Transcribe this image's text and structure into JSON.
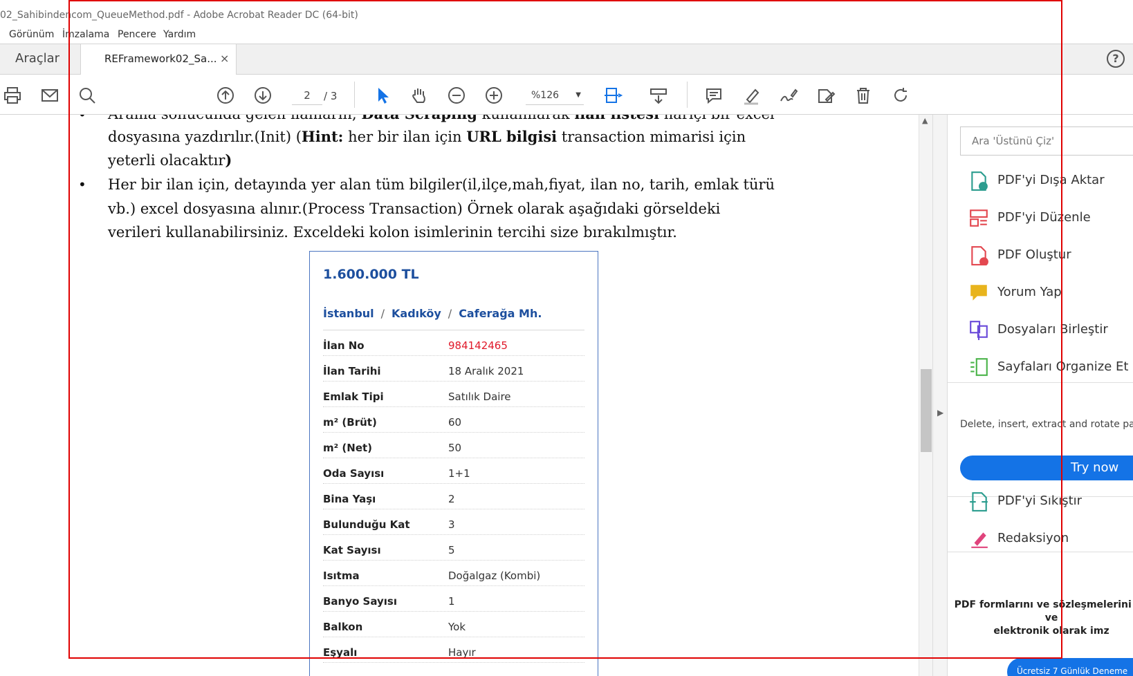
{
  "window": {
    "title": "02_Sahibindencom_QueueMethod.pdf - Adobe Acrobat Reader DC (64-bit)"
  },
  "menu": [
    "Görünüm",
    "İmzalama",
    "Pencere",
    "Yardım"
  ],
  "tabs": {
    "tools": "Araçlar",
    "document": "REFramework02_Sa...",
    "close": "×",
    "help": "?"
  },
  "toolbar": {
    "page_current": "2",
    "page_total": "/ 3",
    "zoom": "%126"
  },
  "document": {
    "lines": [
      "Arama sonucunda gelen ilanların, Data Scraping kullanılarak ilan listesi hariçi bir excel",
      "dosyasına yazdırılır.(Init) (Hint: her bir ilan için URL bilgisi transaction mimarisi için",
      "yeterli olacaktır)",
      "Her bir ilan için, detayında yer alan tüm bilgiler(il,ilçe,mah,fiyat, ilan no, tarih, emlak türü",
      "vb.) excel dosyasına alınır.(Process Transaction) Örnek olarak aşağıdaki görseldeki",
      "verileri kullanabilirsiniz. Exceldeki kolon isimlerinin tercihi size bırakılmıştır."
    ],
    "bold": {
      "hint": "Hint:",
      "url": "URL bilgisi",
      "data_scraping": "Data Scraping",
      "ilan_listesi": "ilan listesi",
      "paren": ")"
    }
  },
  "listing": {
    "price": "1.600.000 TL",
    "location": [
      "İstanbul",
      "Kadıköy",
      "Caferağa Mh."
    ],
    "separator": "/",
    "rows": [
      {
        "k": "İlan No",
        "v": "984142465"
      },
      {
        "k": "İlan Tarihi",
        "v": "18 Aralık 2021"
      },
      {
        "k": "Emlak Tipi",
        "v": "Satılık Daire"
      },
      {
        "k": "m² (Brüt)",
        "v": "60"
      },
      {
        "k": "m² (Net)",
        "v": "50"
      },
      {
        "k": "Oda Sayısı",
        "v": "1+1"
      },
      {
        "k": "Bina Yaşı",
        "v": "2"
      },
      {
        "k": "Bulunduğu Kat",
        "v": "3"
      },
      {
        "k": "Kat Sayısı",
        "v": "5"
      },
      {
        "k": "Isıtma",
        "v": "Doğalgaz (Kombi)"
      },
      {
        "k": "Banyo Sayısı",
        "v": "1"
      },
      {
        "k": "Balkon",
        "v": "Yok"
      },
      {
        "k": "Eşyalı",
        "v": "Hayır"
      }
    ]
  },
  "pane": {
    "search_placeholder": "Ara 'Üstünü Çiz'",
    "tools": [
      {
        "label": "PDF'yi Dışa Aktar",
        "icon": "export-pdf-icon",
        "color": "#2c9d8f"
      },
      {
        "label": "PDF'yi Düzenle",
        "icon": "edit-pdf-icon",
        "color": "#e34850"
      },
      {
        "label": "PDF Oluştur",
        "icon": "create-pdf-icon",
        "color": "#e34850"
      },
      {
        "label": "Yorum Yap",
        "icon": "comment-icon",
        "color": "#e8b41d"
      },
      {
        "label": "Dosyaları Birleştir",
        "icon": "combine-files-icon",
        "color": "#6a4ad9"
      },
      {
        "label": "Sayfaları Organize Et",
        "icon": "organize-pages-icon",
        "color": "#4bb44a"
      }
    ],
    "tools2": [
      {
        "label": "PDF'yi Sıkıştır",
        "icon": "compress-pdf-icon",
        "color": "#2c9d8f"
      },
      {
        "label": "Redaksiyon",
        "icon": "redact-icon",
        "color": "#e0447c"
      }
    ],
    "description": "Delete, insert, extract and rotate pa",
    "try_now": "Try now",
    "promo": [
      "PDF formlarını ve sözleşmelerini dö",
      "ve",
      "elektronik olarak imz"
    ],
    "trial": "Ücretsiz 7 Günlük Deneme"
  },
  "colors": {
    "accent": "#1473e6",
    "link_blue": "#1d4f9e",
    "red": "#e0192a",
    "highlight": "#e00000"
  }
}
